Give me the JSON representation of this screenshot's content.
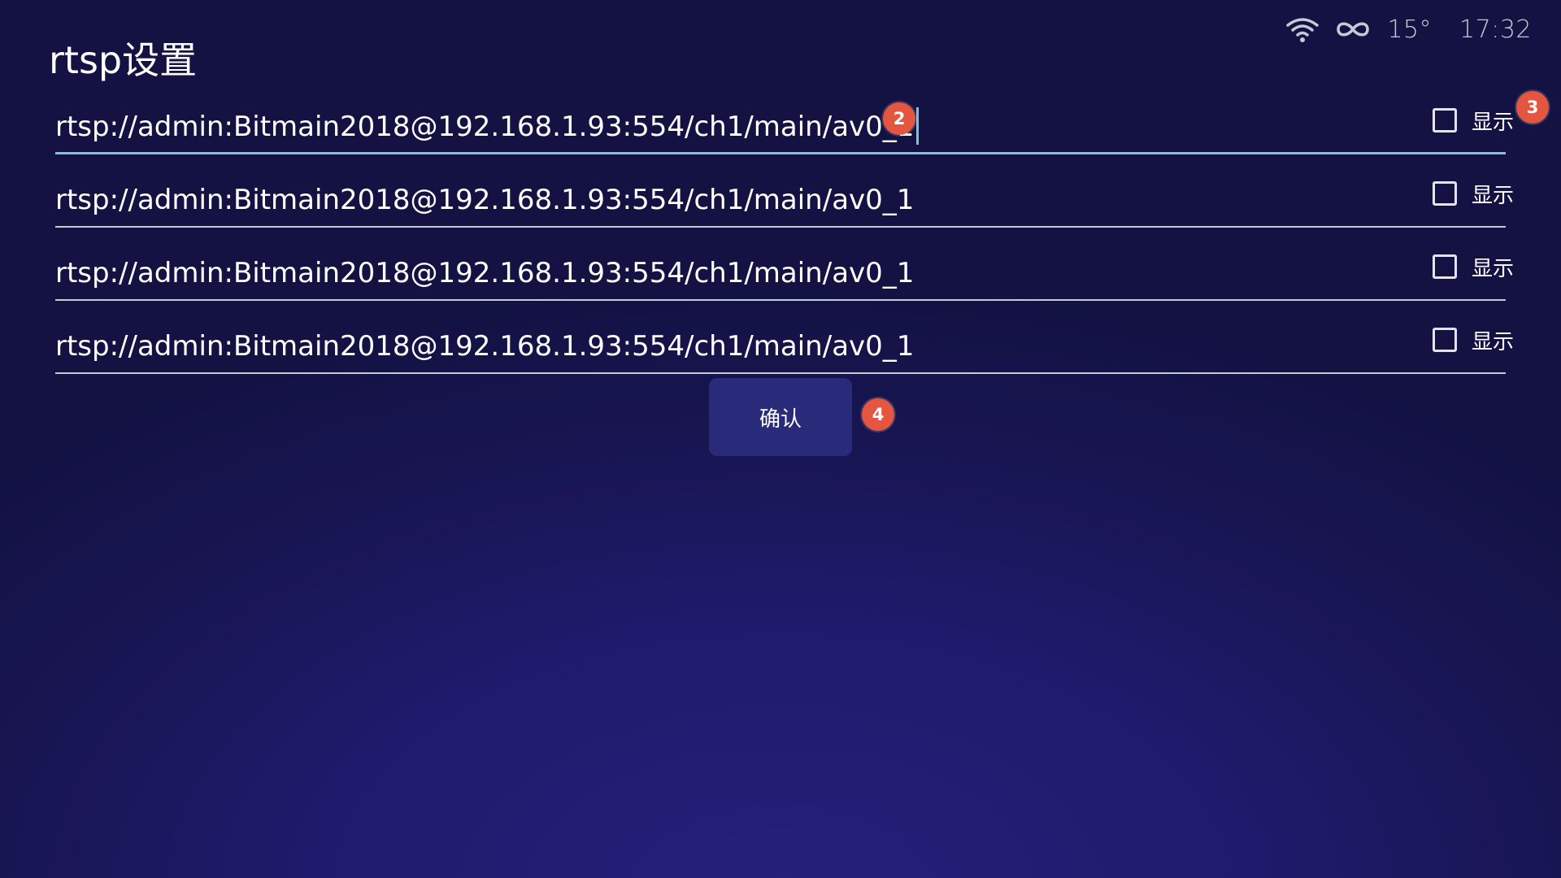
{
  "status_bar": {
    "wifi_icon": "wifi-icon",
    "link_icon": "infinity-icon",
    "temperature": "15°",
    "time": "17:32"
  },
  "page": {
    "title": "rtsp设置"
  },
  "rows": [
    {
      "url": "rtsp://admin:Bitmain2018@192.168.1.93:554/ch1/main/av0_1",
      "show_label": "显示",
      "checked": false,
      "focused": true
    },
    {
      "url": "rtsp://admin:Bitmain2018@192.168.1.93:554/ch1/main/av0_1",
      "show_label": "显示",
      "checked": false,
      "focused": false
    },
    {
      "url": "rtsp://admin:Bitmain2018@192.168.1.93:554/ch1/main/av0_1",
      "show_label": "显示",
      "checked": false,
      "focused": false
    },
    {
      "url": "rtsp://admin:Bitmain2018@192.168.1.93:554/ch1/main/av0_1",
      "show_label": "显示",
      "checked": false,
      "focused": false
    }
  ],
  "confirm": {
    "label": "确认"
  },
  "badges": {
    "url_field": "2",
    "show_checkbox": "3",
    "confirm_button": "4"
  },
  "colors": {
    "background": "#1b1760",
    "focus_underline": "#7fc4d6",
    "badge": "#e4563f",
    "button": "#2a2a7a"
  }
}
